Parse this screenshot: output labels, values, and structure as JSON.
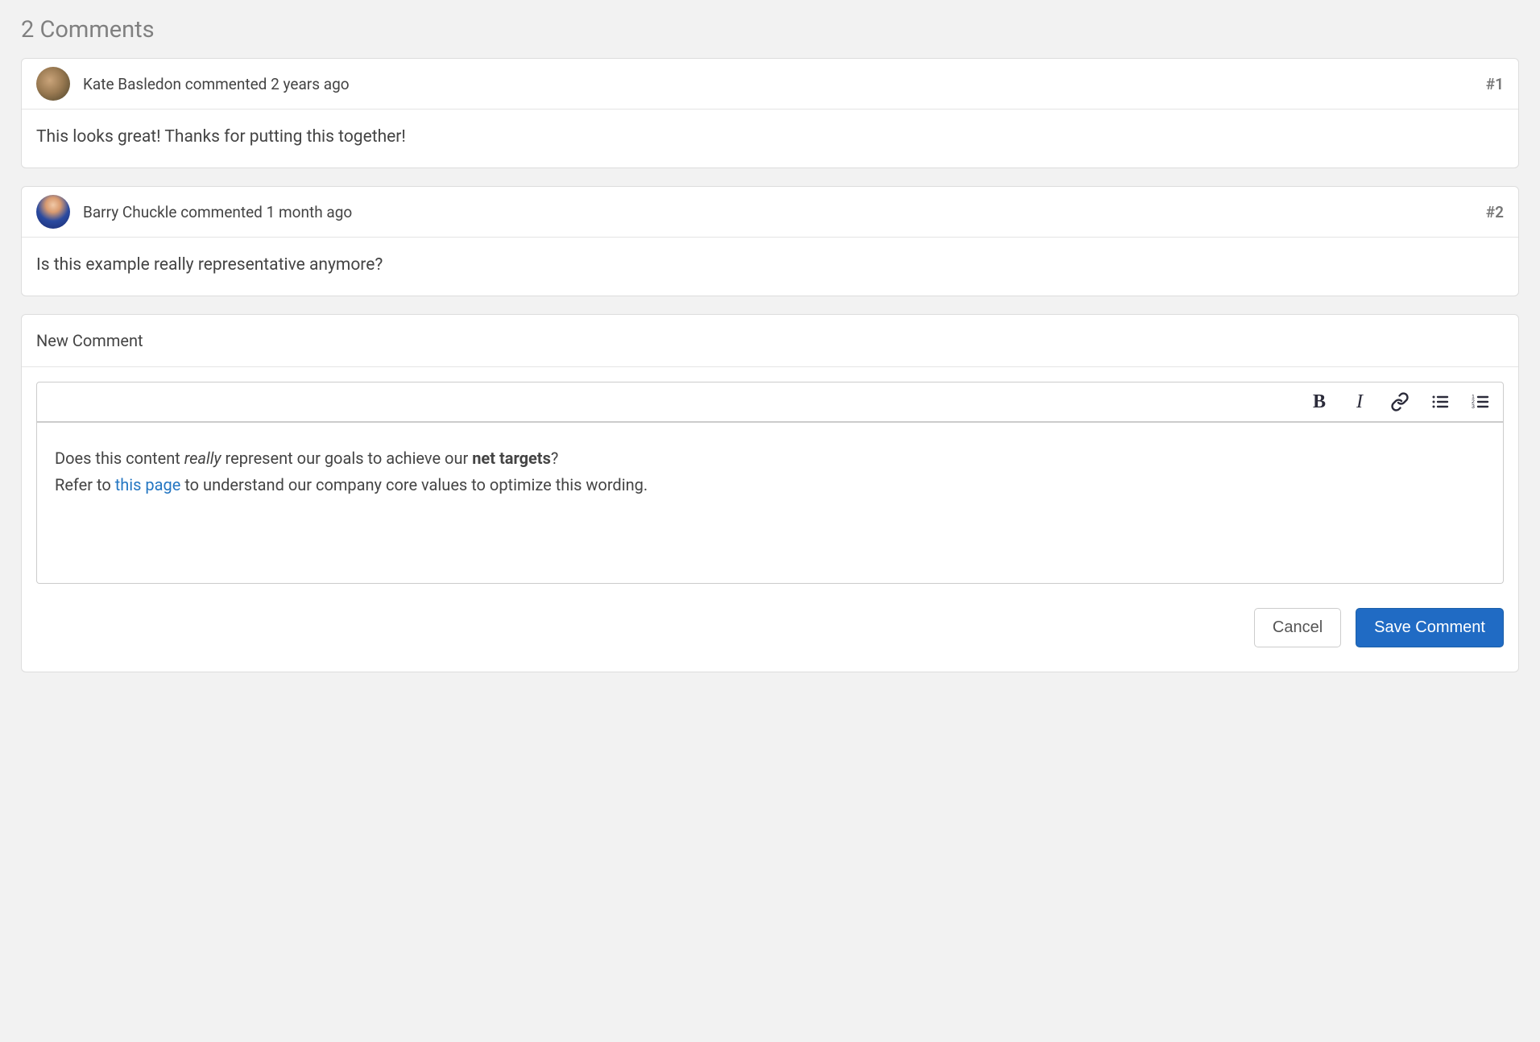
{
  "section_title": "2 Comments",
  "comments": [
    {
      "author": "Kate Basledon",
      "verb": "commented",
      "time": "2 years ago",
      "number": "#1",
      "body": "This looks great! Thanks for putting this together!"
    },
    {
      "author": "Barry Chuckle",
      "verb": "commented",
      "time": "1 month ago",
      "number": "#2",
      "body": "Is this example really representative anymore?"
    }
  ],
  "new_comment": {
    "header": "New Comment",
    "draft": {
      "line1_pre": "Does this content ",
      "line1_em": "really",
      "line1_mid": " represent our goals to achieve our ",
      "line1_strong": "net targets",
      "line1_post": "?",
      "line2_pre": "Refer to ",
      "line2_link": "this page",
      "line2_post": " to understand our company core values to optimize this wording."
    }
  },
  "actions": {
    "cancel": "Cancel",
    "save": "Save Comment"
  },
  "toolbar": {
    "bold": "B",
    "italic": "I"
  }
}
